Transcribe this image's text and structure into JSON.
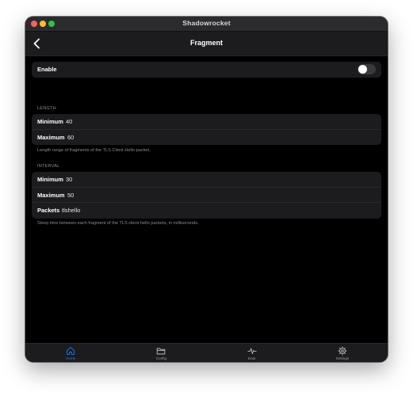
{
  "window": {
    "title": "Shadowrocket"
  },
  "navbar": {
    "title": "Fragment",
    "back_icon": "chevron-left-icon"
  },
  "enable": {
    "label": "Enable",
    "on": false
  },
  "length": {
    "header": "LENGTH",
    "minimum_label": "Minimum",
    "minimum_value": "40",
    "maximum_label": "Maximum",
    "maximum_value": "60",
    "footer": "Length range of fragments of the TLS Client Hello packet."
  },
  "interval": {
    "header": "INTERVAL",
    "minimum_label": "Minimum",
    "minimum_value": "30",
    "maximum_label": "Maximum",
    "maximum_value": "50",
    "packets_label": "Packets",
    "packets_value": "tlshello",
    "footer": "Sleep time between each fragment of the TLS client hello packets, in milliseconds."
  },
  "tabbar": {
    "tabs": [
      {
        "label": "Home",
        "icon": "home-icon",
        "active": true
      },
      {
        "label": "Config",
        "icon": "folder-icon",
        "active": false
      },
      {
        "label": "Data",
        "icon": "activity-icon",
        "active": false
      },
      {
        "label": "Settings",
        "icon": "gear-icon",
        "active": false
      }
    ]
  },
  "colors": {
    "accent": "#0a84ff",
    "background": "#000000",
    "cell": "#1c1c1e",
    "secondary_text": "#8a8a8e"
  }
}
